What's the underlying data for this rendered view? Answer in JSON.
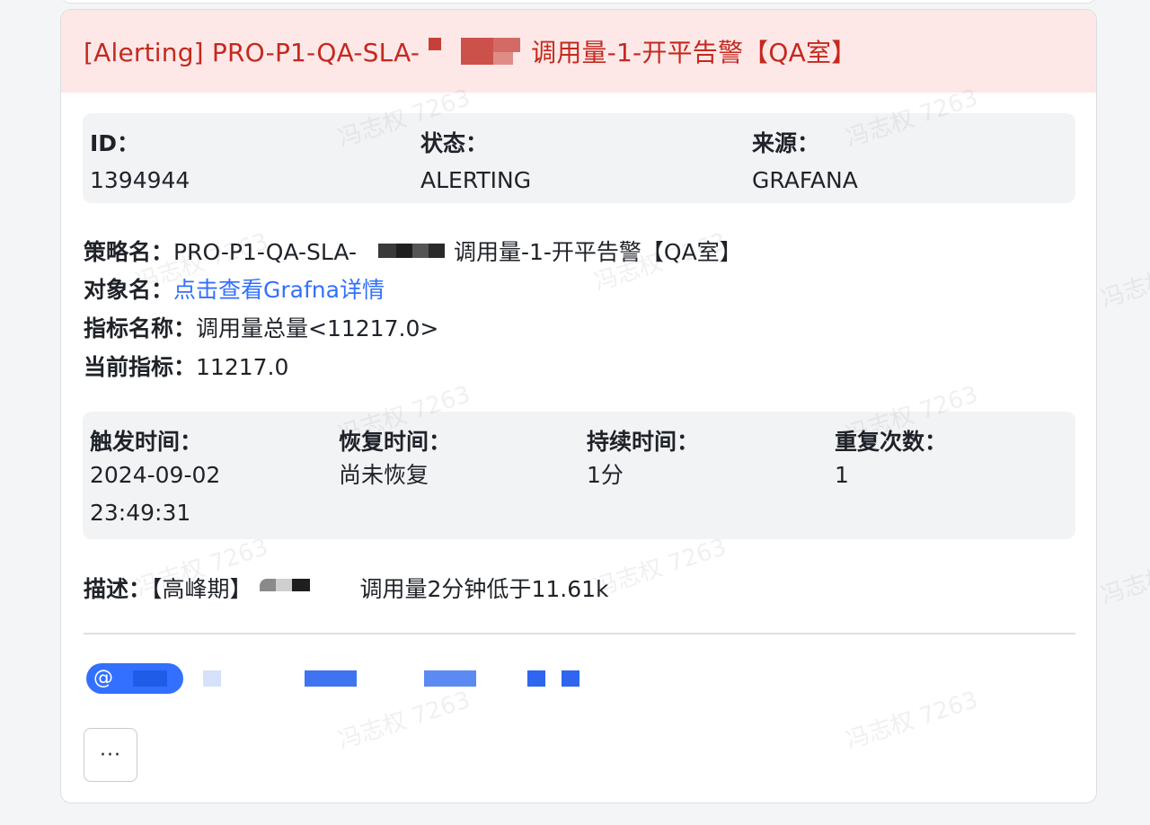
{
  "header": {
    "title_prefix": "[Alerting] PRO-P1-QA-SLA-",
    "title_suffix": "调用量-1-开平告警【QA室】"
  },
  "summary": {
    "id_label": "ID：",
    "id_value": "1394944",
    "status_label": "状态：",
    "status_value": "ALERTING",
    "source_label": "来源：",
    "source_value": "GRAFANA"
  },
  "details": {
    "policy_label": "策略名：",
    "policy_prefix": "PRO-P1-QA-SLA-",
    "policy_suffix": "调用量-1-开平告警【QA室】",
    "object_label": "对象名：",
    "object_link": "点击查看Grafna详情",
    "metric_name_label": "指标名称：",
    "metric_name_value": "调用量总量<11217.0>",
    "current_metric_label": "当前指标：",
    "current_metric_value": "11217.0"
  },
  "timing": {
    "trigger_label": "触发时间：",
    "trigger_value": "2024-09-02\n23:49:31",
    "recover_label": "恢复时间：",
    "recover_value": "尚未恢复",
    "duration_label": "持续时间：",
    "duration_value": "1分",
    "repeat_label": "重复次数：",
    "repeat_value": "1"
  },
  "description": {
    "label": "描述：",
    "prefix": "【高峰期】",
    "suffix": "调用量2分钟低于11.61k"
  },
  "mentions": {
    "at_symbol": "@"
  },
  "actions": {
    "more_label": "···"
  },
  "watermark": "冯志权 7263",
  "colors": {
    "accent": "#3370ff",
    "alert_red": "#c4291f",
    "header_bg": "#fde8e7",
    "panel_bg": "#f2f3f5"
  }
}
